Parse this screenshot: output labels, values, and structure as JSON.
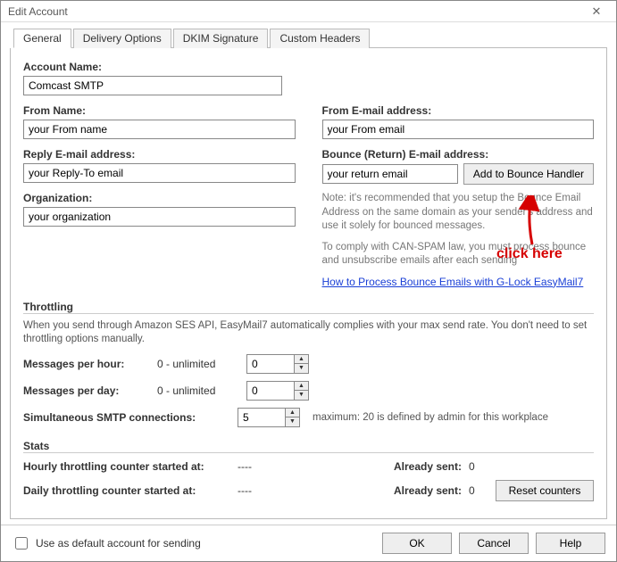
{
  "window": {
    "title": "Edit Account"
  },
  "tabs": {
    "general": "General",
    "delivery": "Delivery Options",
    "dkim": "DKIM Signature",
    "custom": "Custom Headers"
  },
  "fields": {
    "accountName": {
      "label": "Account Name:",
      "value": "Comcast SMTP"
    },
    "fromName": {
      "label": "From Name:",
      "value": "your From name"
    },
    "fromEmail": {
      "label": "From E-mail address:",
      "value": "your From email"
    },
    "replyEmail": {
      "label": "Reply E-mail address:",
      "value": "your Reply-To email"
    },
    "bounceEmail": {
      "label": "Bounce (Return) E-mail address:",
      "value": "your return email"
    },
    "organization": {
      "label": "Organization:",
      "value": "your organization"
    }
  },
  "bounce": {
    "button": "Add to Bounce Handler",
    "note1": "Note: it's recommended that you setup the Bounce Email Address on the same domain as your sender's address and use it solely for bounced messages.",
    "note2": "To comply with CAN-SPAM law, you must process bounce and unsubscribe emails after each sending",
    "link": "How to Process Bounce Emails with G-Lock EasyMail7"
  },
  "throttling": {
    "title": "Throttling",
    "desc": "When you send through Amazon SES API, EasyMail7 automatically complies with your max send rate. You don't need to set throttling options manually.",
    "perHour": {
      "label": "Messages per hour:",
      "info": "0 - unlimited",
      "value": "0"
    },
    "perDay": {
      "label": "Messages per day:",
      "info": "0 - unlimited",
      "value": "0"
    },
    "smtp": {
      "label": "Simultaneous SMTP connections:",
      "value": "5",
      "max": "maximum: 20 is defined by admin for this workplace"
    }
  },
  "stats": {
    "title": "Stats",
    "hourly": {
      "label": "Hourly throttling counter started at:",
      "value": "----",
      "sentLabel": "Already sent:",
      "sent": "0"
    },
    "daily": {
      "label": "Daily throttling counter started at:",
      "value": "----",
      "sentLabel": "Already sent:",
      "sent": "0"
    },
    "reset": "Reset counters"
  },
  "bottom": {
    "default": "Use as default account for sending",
    "ok": "OK",
    "cancel": "Cancel",
    "help": "Help"
  },
  "annotation": {
    "text": "click here"
  }
}
